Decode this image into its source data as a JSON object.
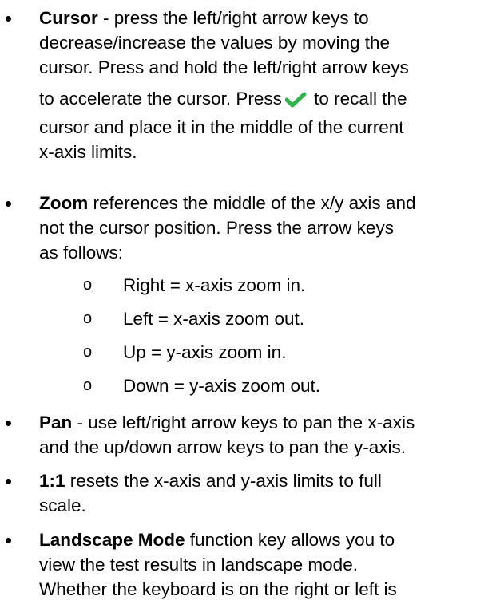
{
  "items": [
    {
      "term": "Cursor",
      "lines": [
        " - press the left/right arrow keys to",
        "decrease/increase the values by moving the",
        "cursor. Press and hold the left/right arrow keys",
        "to accelerate the cursor. Press",
        " to recall the",
        "cursor and place it in the middle of the current",
        "x-axis limits."
      ]
    },
    {
      "term": "Zoom",
      "lines": [
        " references the middle of the x/y axis and",
        "not the cursor position. Press the arrow keys",
        "as follows:"
      ],
      "subitems": [
        {
          "marker": "o",
          "text": "Right = x-axis zoom in."
        },
        {
          "marker": "o",
          "text": "Left = x-axis zoom out."
        },
        {
          "marker": "o",
          "text": "Up = y-axis zoom in."
        },
        {
          "marker": "o",
          "text": "Down = y-axis zoom out."
        }
      ]
    },
    {
      "term": "Pan",
      "lines": [
        " - use left/right arrow keys to pan the x-axis",
        "and the up/down arrow keys to pan the y-axis."
      ]
    },
    {
      "term": "1:1",
      "lines": [
        " resets the x-axis and y-axis limits to full",
        "scale."
      ]
    },
    {
      "term": "Landscape Mode",
      "lines": [
        " function key allows you to",
        "view the test results in landscape mode.",
        "Whether the keyboard is on the right or left is"
      ]
    }
  ],
  "icons": {
    "check_icon": "checkmark",
    "check_color": "#2db34a"
  }
}
